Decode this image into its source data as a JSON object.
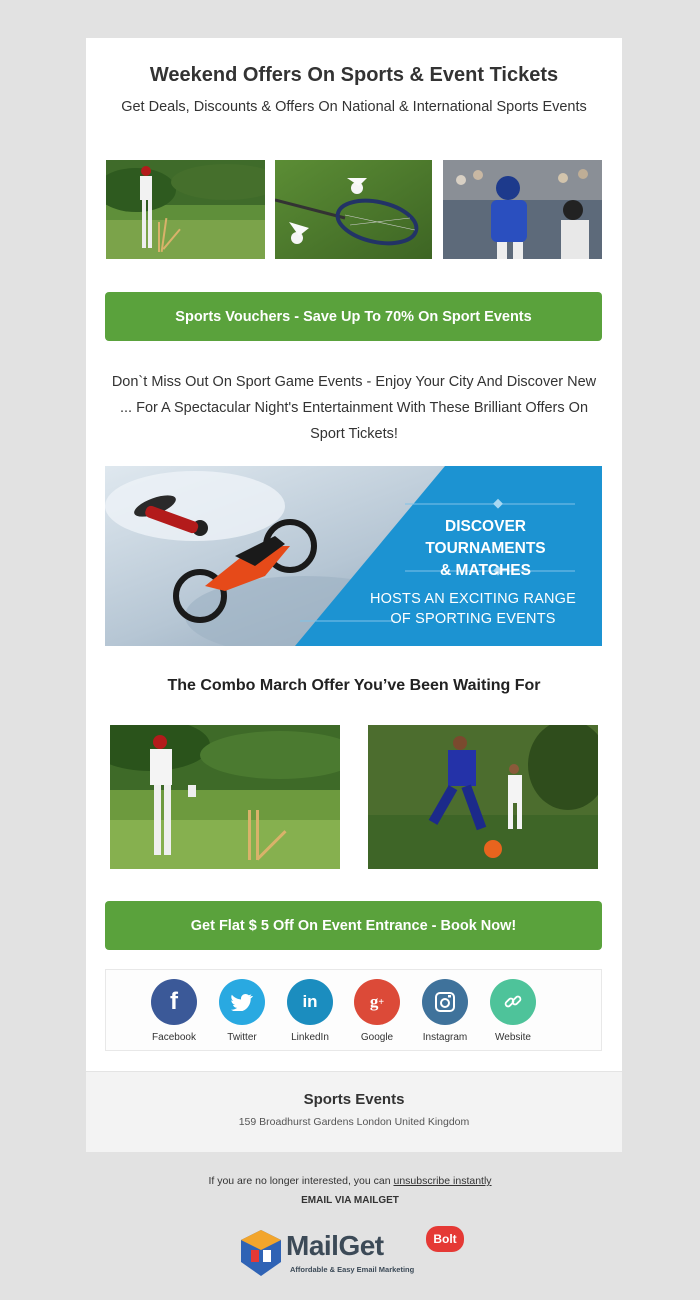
{
  "email": {
    "title": "Weekend Offers On Sports & Event Tickets",
    "subtitle": "Get Deals, Discounts & Offers On National & International Sports Events",
    "cta_primary": "Sports Vouchers - Save Up To 70% On Sport Events",
    "paragraph": "Don`t Miss Out On Sport Game Events - Enjoy Your City And Discover New ... For A Spectacular Night's Entertainment With These Brilliant Offers On Sport Tickets!",
    "banner": {
      "headline_line1": "DISCOVER TOURNAMENTS",
      "headline_line2": "& MATCHES",
      "subline_line1": "HOSTS AN EXCITING RANGE",
      "subline_line2": "OF SPORTING EVENTS"
    },
    "combo_heading": "The Combo March Offer You’ve Been Waiting For",
    "cta_secondary": "Get Flat $ 5 Off On Event Entrance - Book Now!",
    "social": [
      {
        "label": "Facebook",
        "icon": "facebook-icon",
        "color": "#3b5998",
        "glyph": "f"
      },
      {
        "label": "Twitter",
        "icon": "twitter-icon",
        "color": "#29a9e1",
        "glyph": "t"
      },
      {
        "label": "LinkedIn",
        "icon": "linkedin-icon",
        "color": "#1b8dbf",
        "glyph": "in"
      },
      {
        "label": "Google",
        "icon": "google-plus-icon",
        "color": "#dc4a38",
        "glyph": "g+"
      },
      {
        "label": "Instagram",
        "icon": "instagram-icon",
        "color": "#3f729b",
        "glyph": "ig"
      },
      {
        "label": "Website",
        "icon": "link-icon",
        "color": "#4ec39a",
        "glyph": "link"
      }
    ],
    "footer": {
      "company": "Sports Events",
      "address": "159 Broadhurst Gardens London United Kingdom"
    }
  },
  "meta": {
    "unsubscribe_prefix": "If you are no longer interested, you can ",
    "unsubscribe_link": "unsubscribe instantly",
    "via": "EMAIL VIA MAILGET",
    "logo_word": "MailGet",
    "logo_badge": "Bolt",
    "logo_tagline": "Affordable & Easy Email Marketing"
  },
  "colors": {
    "page_bg": "#e2e2e2",
    "button_green": "#5aa23c",
    "banner_blue": "#1c93d2"
  }
}
